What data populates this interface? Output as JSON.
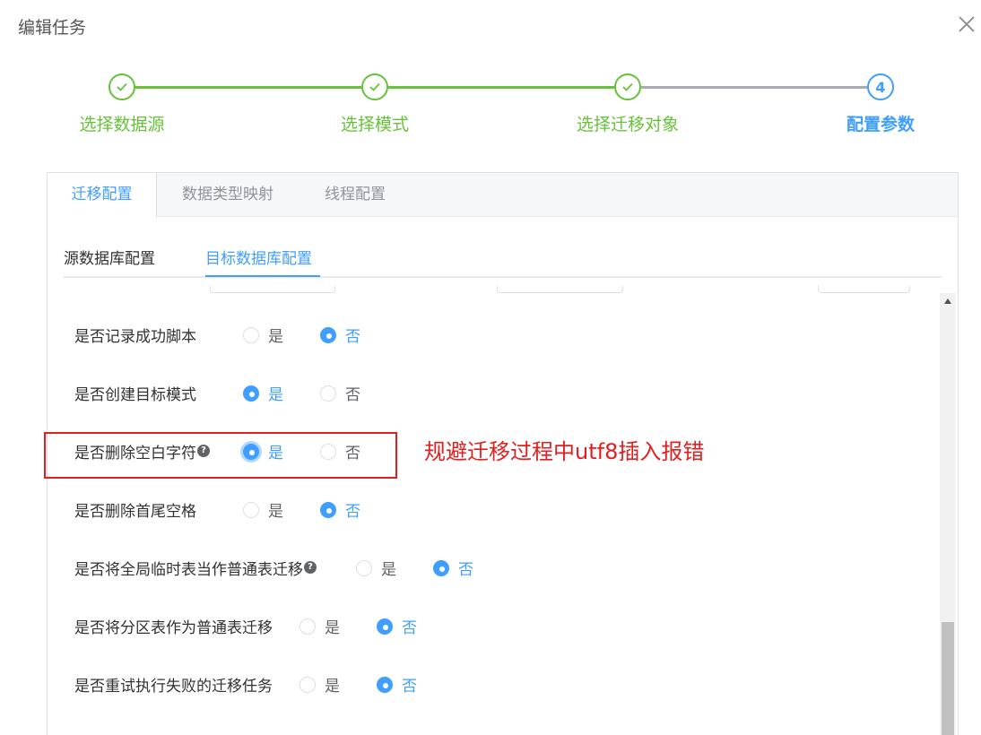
{
  "dialog": {
    "title": "编辑任务"
  },
  "steps": [
    {
      "label": "选择数据源",
      "status": "done"
    },
    {
      "label": "选择模式",
      "status": "done"
    },
    {
      "label": "选择迁移对象",
      "status": "done"
    },
    {
      "label": "配置参数",
      "status": "active",
      "number": "4"
    }
  ],
  "tabs": [
    {
      "label": "迁移配置",
      "active": true
    },
    {
      "label": "数据类型映射",
      "active": false
    },
    {
      "label": "线程配置",
      "active": false
    }
  ],
  "subtabs": [
    {
      "label": "源数据库配置",
      "active": false
    },
    {
      "label": "目标数据库配置",
      "active": true
    }
  ],
  "options": [
    {
      "label": "是否记录成功脚本",
      "help": false,
      "yes": "是",
      "no": "否",
      "selected": "no"
    },
    {
      "label": "是否创建目标模式",
      "help": false,
      "yes": "是",
      "no": "否",
      "selected": "yes"
    },
    {
      "label": "是否删除空白字符",
      "help": true,
      "yes": "是",
      "no": "否",
      "selected": "yes"
    },
    {
      "label": "是否删除首尾空格",
      "help": false,
      "yes": "是",
      "no": "否",
      "selected": "no"
    },
    {
      "label": "是否将全局临时表当作普通表迁移",
      "help": true,
      "yes": "是",
      "no": "否",
      "selected": "no"
    },
    {
      "label": "是否将分区表作为普通表迁移",
      "help": false,
      "yes": "是",
      "no": "否",
      "selected": "no"
    },
    {
      "label": "是否重试执行失败的迁移任务",
      "help": false,
      "yes": "是",
      "no": "否",
      "selected": "no"
    }
  ],
  "annotation": {
    "text": "规避迁移过程中utf8插入报错"
  },
  "colors": {
    "primary": "#409eff",
    "success": "#67c23a",
    "annotation": "#e02020"
  }
}
